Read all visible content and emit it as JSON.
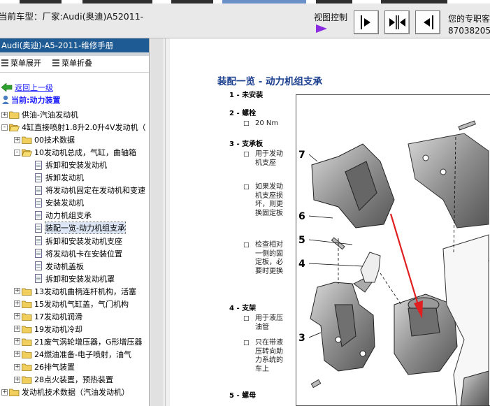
{
  "header": {
    "car_model": "当前车型：厂家:Audi(奥迪)A52011-",
    "view_control": "视图控制",
    "contact_line1": "您的专职客",
    "contact_line2": "87038205"
  },
  "sidebar": {
    "manual_title": "Audi(奥迪)-A5-2011-维修手册",
    "expand_menu": "菜单展开",
    "collapse_menu": "菜单折叠",
    "back_link": "返回上一级",
    "current": "当前:动力装置",
    "tree": [
      {
        "label": "供油-汽油发动机",
        "depth": 0,
        "kind": "folder",
        "expander": "+"
      },
      {
        "label": "4缸直接喷射1.8升2.0升4V发动机（",
        "depth": 0,
        "kind": "folder-open",
        "expander": "-"
      },
      {
        "label": "00技术数据",
        "depth": 1,
        "kind": "folder",
        "expander": "+"
      },
      {
        "label": "10发动机总成，气缸，曲轴箱",
        "depth": 1,
        "kind": "folder-open",
        "expander": "-"
      },
      {
        "label": "拆卸和安装发动机",
        "depth": 2,
        "kind": "doc"
      },
      {
        "label": "拆卸发动机",
        "depth": 2,
        "kind": "doc"
      },
      {
        "label": "将发动机固定在发动机和变速",
        "depth": 2,
        "kind": "doc"
      },
      {
        "label": "安装发动机",
        "depth": 2,
        "kind": "doc"
      },
      {
        "label": "动力机组支承",
        "depth": 2,
        "kind": "doc"
      },
      {
        "label": "装配一览-动力机组支承",
        "depth": 2,
        "kind": "doc",
        "selected": true
      },
      {
        "label": "拆卸和安装发动机支座",
        "depth": 2,
        "kind": "doc"
      },
      {
        "label": "将发动机卡在安装位置",
        "depth": 2,
        "kind": "doc"
      },
      {
        "label": "发动机盖板",
        "depth": 2,
        "kind": "doc"
      },
      {
        "label": "拆卸和安装发动机罩",
        "depth": 2,
        "kind": "doc"
      },
      {
        "label": "13发动机曲柄连杆机构，活塞",
        "depth": 1,
        "kind": "folder",
        "expander": "+"
      },
      {
        "label": "15发动机气缸盖，气门机构",
        "depth": 1,
        "kind": "folder",
        "expander": "+"
      },
      {
        "label": "17发动机润滑",
        "depth": 1,
        "kind": "folder",
        "expander": "+"
      },
      {
        "label": "19发动机冷却",
        "depth": 1,
        "kind": "folder",
        "expander": "+"
      },
      {
        "label": "21废气涡轮增压器，G形增压器",
        "depth": 1,
        "kind": "folder",
        "expander": "+"
      },
      {
        "label": "24燃油准备-电子喷射，油气",
        "depth": 1,
        "kind": "folder",
        "expander": "+"
      },
      {
        "label": "26排气装置",
        "depth": 1,
        "kind": "folder",
        "expander": "+"
      },
      {
        "label": "28点火装置，预热装置",
        "depth": 1,
        "kind": "folder",
        "expander": "+"
      },
      {
        "label": "发动机技术数据（汽油发动机）",
        "depth": 0,
        "kind": "folder",
        "expander": "+"
      }
    ]
  },
  "content": {
    "title": "装配一览 - 动力机组支承",
    "legend": [
      {
        "heading": "1 - 未安装",
        "bullets": []
      },
      {
        "heading": "2 - 螺栓",
        "bullets": [
          "20 Nm"
        ]
      },
      {
        "heading": "3 - 支承板",
        "bullets": [
          "用于发动机支座",
          "如果发动机支座损坏，则更换固定板",
          "检查相对一侧的固定板，必要时更换"
        ]
      },
      {
        "heading": "4 - 支架",
        "bullets": [
          "用于液压油管",
          "只在带液压转向助力系统的车上"
        ]
      },
      {
        "heading": "5 - 螺母",
        "bullets": []
      }
    ],
    "figure_labels": [
      "7",
      "6",
      "5",
      "4",
      "3"
    ]
  },
  "colors": {
    "title_bar": "#1e5a94",
    "link": "#1a1aff",
    "doc_title": "#1b3f8f",
    "arrow": "#e02020",
    "play_icon": "#8a2be2"
  }
}
